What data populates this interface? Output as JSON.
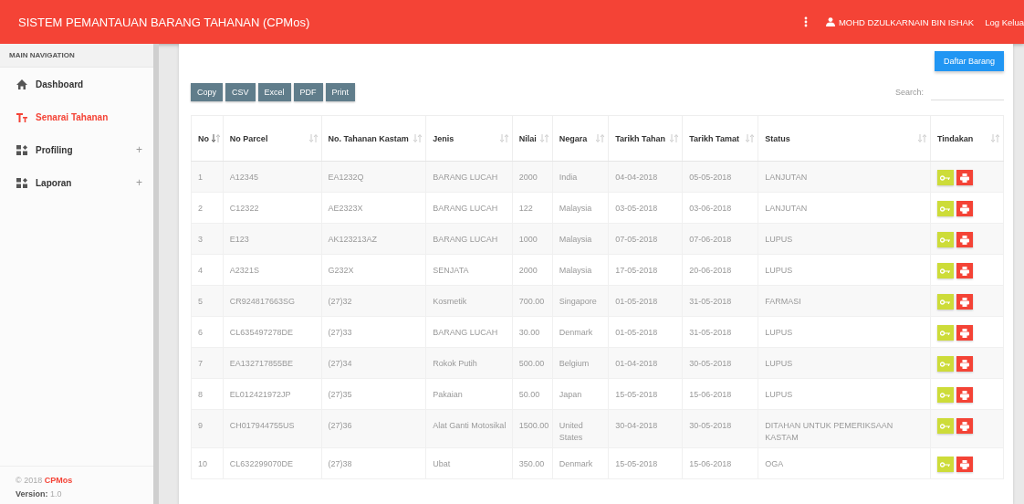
{
  "header": {
    "title": "SISTEM PEMANTAUAN BARANG TAHANAN (CPMos)",
    "user": "MOHD DZULKARNAIN BIN ISHAK",
    "logout": "Log Kelua"
  },
  "sidebar": {
    "heading": "MAIN NAVIGATION",
    "items": [
      {
        "label": "Dashboard",
        "kind": "home",
        "selected": false
      },
      {
        "label": "Senarai Tahanan",
        "kind": "text",
        "selected": true
      },
      {
        "label": "Profiling",
        "kind": "widgets",
        "selected": false,
        "expand": "+"
      },
      {
        "label": "Laporan",
        "kind": "widgets",
        "selected": false,
        "expand": "+"
      }
    ],
    "footer": "© 2018 **CPMos**",
    "version": "**Version:** 1.0"
  },
  "add_button": "Daftar Barang",
  "export_buttons": [
    "Copy",
    "CSV",
    "Excel",
    "PDF",
    "Print"
  ],
  "search": {
    "label": "Search:"
  },
  "table": {
    "columns": [
      {
        "label": "No",
        "sorted": true
      },
      {
        "label": "No Parcel",
        "sorted": false
      },
      {
        "label": "No. Tahanan Kastam",
        "sorted": false
      },
      {
        "label": "Jenis",
        "sorted": false
      },
      {
        "label": "Nilai",
        "sorted": false
      },
      {
        "label": "Negara",
        "sorted": false
      },
      {
        "label": "Tarikh Tahan",
        "sorted": false
      },
      {
        "label": "Tarikh Tamat",
        "sorted": false
      },
      {
        "label": "Status",
        "sorted": false
      },
      {
        "label": "Tindakan",
        "sorted": false
      }
    ],
    "rows": [
      [
        "1",
        "A12345",
        "EA1232Q",
        "BARANG LUCAH",
        "2000",
        "India",
        "04-04-2018",
        "05-05-2018",
        "LANJUTAN"
      ],
      [
        "2",
        "C12322",
        "AE2323X",
        "BARANG LUCAH",
        "122",
        "Malaysia",
        "03-05-2018",
        "03-06-2018",
        "LANJUTAN"
      ],
      [
        "3",
        "E123",
        "AK123213AZ",
        "BARANG LUCAH",
        "1000",
        "Malaysia",
        "07-05-2018",
        "07-06-2018",
        "LUPUS"
      ],
      [
        "4",
        "A2321S",
        "G232X",
        "SENJATA",
        "2000",
        "Malaysia",
        "17-05-2018",
        "20-06-2018",
        "LUPUS"
      ],
      [
        "5",
        "CR924817663SG",
        "(27)32",
        "Kosmetik",
        "700.00",
        "Singapore",
        "01-05-2018",
        "31-05-2018",
        "FARMASI"
      ],
      [
        "6",
        "CL635497278DE",
        "(27)33",
        "BARANG LUCAH",
        "30.00",
        "Denmark",
        "01-05-2018",
        "31-05-2018",
        "LUPUS"
      ],
      [
        "7",
        "EA132717855BE",
        "(27)34",
        "Rokok Putih",
        "500.00",
        "Belgium",
        "01-04-2018",
        "30-05-2018",
        "LUPUS"
      ],
      [
        "8",
        "EL012421972JP",
        "(27)35",
        "Pakaian",
        "50.00",
        "Japan",
        "15-05-2018",
        "15-06-2018",
        "LUPUS"
      ],
      [
        "9",
        "CH017944755US",
        "(27)36",
        "Alat Ganti Motosikal",
        "1500.00",
        "United States",
        "30-04-2018",
        "30-05-2018",
        "DITAHAN UNTUK PEMERIKSAAN KASTAM"
      ],
      [
        "10",
        "CL632299070DE",
        "(27)38",
        "Ubat",
        "350.00",
        "Denmark",
        "15-05-2018",
        "15-06-2018",
        "OGA"
      ]
    ]
  }
}
